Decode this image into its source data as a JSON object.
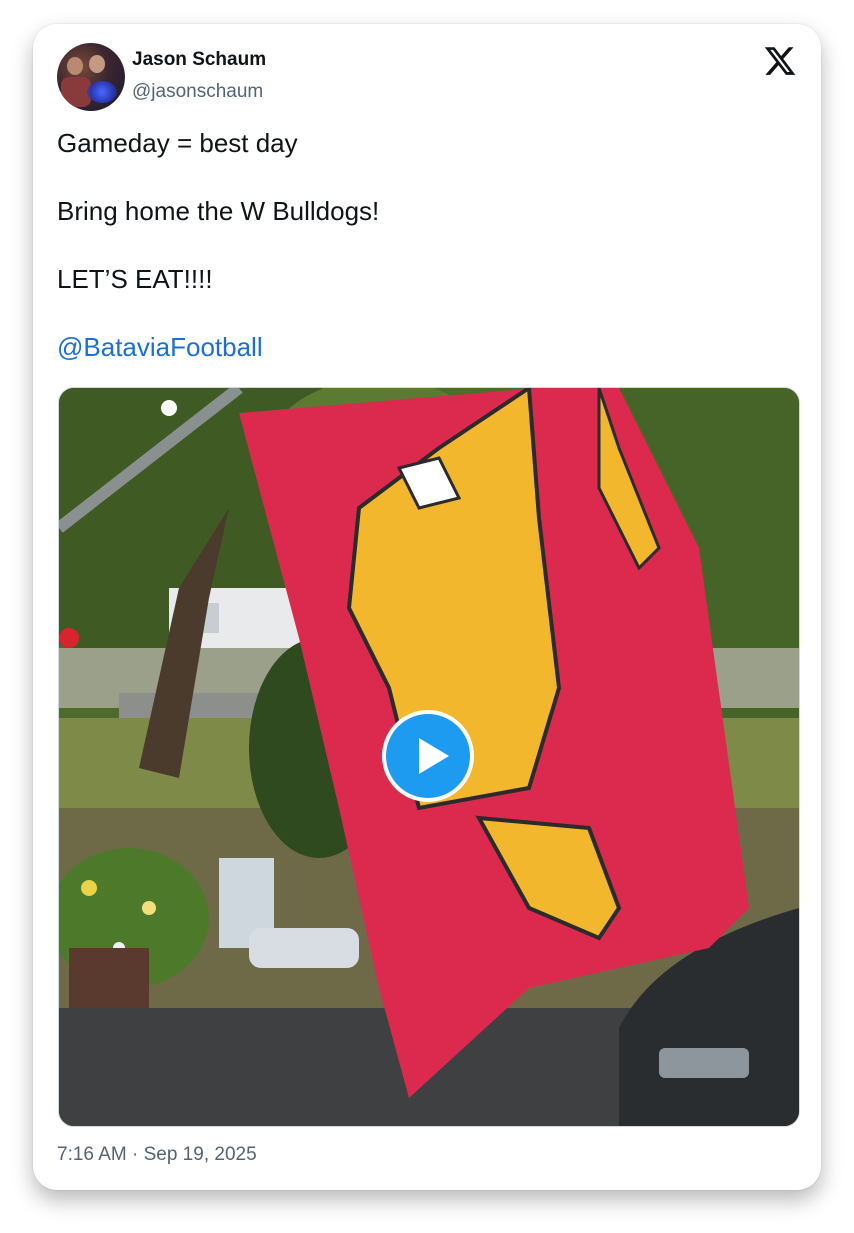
{
  "author": {
    "display_name": "Jason Schaum",
    "handle": "@jasonschaum"
  },
  "tweet": {
    "lines": [
      "Gameday = best day",
      "Bring home the W Bulldogs!",
      "LET’S EAT!!!!"
    ],
    "mention": "@BataviaFootball"
  },
  "media": {
    "type": "video",
    "play_icon": "play-icon"
  },
  "timestamp": "7:16 AM · Sep 19, 2025",
  "colors": {
    "link": "#1d6fd6",
    "play_button": "#1d9bf0",
    "flag_red": "#dc2a4f",
    "flag_gold": "#f2b72d"
  },
  "icons": [
    "x-logo-icon",
    "play-icon"
  ]
}
